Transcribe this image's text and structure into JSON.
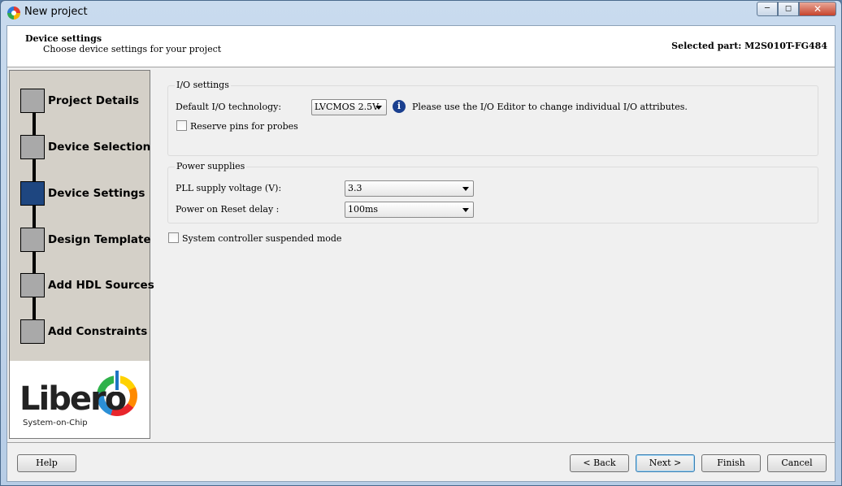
{
  "window": {
    "title": "New project",
    "min_icon": "minimize-icon",
    "max_icon": "maximize-icon",
    "close_icon": "close-icon"
  },
  "header": {
    "title": "Device settings",
    "subtitle": "Choose device settings for your project",
    "selected_part": "Selected part: M2S010T-FG484"
  },
  "wizard": {
    "steps": [
      {
        "label": "Project Details",
        "active": false
      },
      {
        "label": "Device Selection",
        "active": false
      },
      {
        "label": "Device Settings",
        "active": true
      },
      {
        "label": "Design Template",
        "active": false
      },
      {
        "label": "Add HDL Sources",
        "active": false
      },
      {
        "label": "Add Constraints",
        "active": false
      }
    ],
    "logo": {
      "word": "Libero",
      "tagline": "System-on-Chip"
    }
  },
  "io_settings": {
    "group_title": "I/O settings",
    "default_io_label": "Default I/O technology:",
    "default_io_value": "LVCMOS 2.5V",
    "info_text": "Please use the I/O Editor to change individual I/O attributes.",
    "reserve_pins_label": "Reserve pins for probes",
    "reserve_pins_checked": false
  },
  "power_supplies": {
    "group_title": "Power supplies",
    "pll_label": "PLL supply voltage (V):",
    "pll_value": "3.3",
    "por_label": "Power on Reset delay :",
    "por_value": "100ms"
  },
  "system_controller": {
    "label": "System controller suspended mode",
    "checked": false
  },
  "footer": {
    "help": "Help",
    "back": "< Back",
    "next": "Next >",
    "finish": "Finish",
    "cancel": "Cancel"
  },
  "colors": {
    "active_step": "#1e4680",
    "inactive_step": "#a9a9a9",
    "wizard_bg": "#d4d0c8",
    "dialog_bg": "#f0f0f0"
  }
}
